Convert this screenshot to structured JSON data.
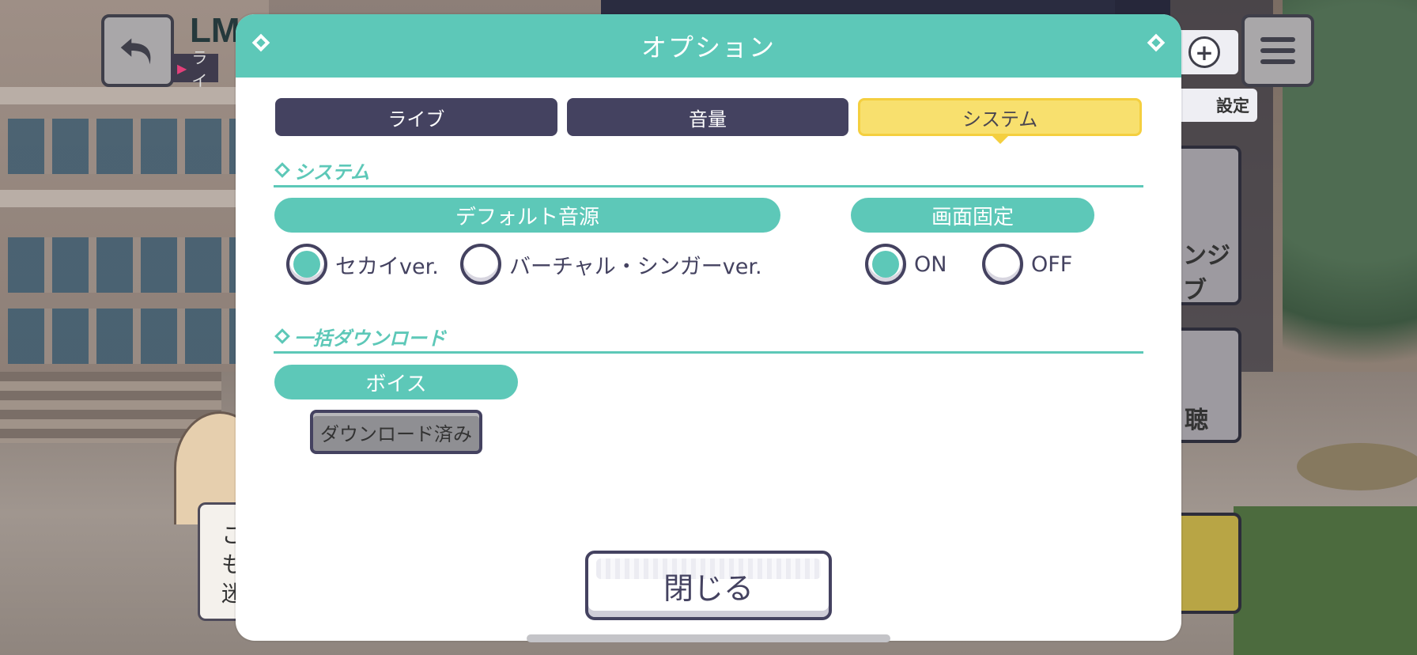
{
  "modal": {
    "title": "オプション",
    "tabs": [
      {
        "label": "ライブ",
        "active": false
      },
      {
        "label": "音量",
        "active": false
      },
      {
        "label": "システム",
        "active": true
      }
    ],
    "sections": {
      "system": {
        "title": "システム",
        "default_source": {
          "label": "デフォルト音源",
          "options": [
            {
              "label": "セカイver.",
              "selected": true
            },
            {
              "label": "バーチャル・シンガーver.",
              "selected": false
            }
          ]
        },
        "screen_lock": {
          "label": "画面固定",
          "options": [
            {
              "label": "ON",
              "selected": true
            },
            {
              "label": "OFF",
              "selected": false
            }
          ]
        }
      },
      "bulk_download": {
        "title": "一括ダウンロード",
        "voice": {
          "label": "ボイス",
          "button_label": "ダウンロード済み"
        }
      }
    },
    "close_label": "閉じる"
  },
  "background_ui": {
    "title_fragment": "LM",
    "subtab_fragment": "ライ",
    "settings_label": "設定",
    "card_texts": [
      "ンジ",
      "ブ",
      "聴"
    ],
    "speech_fragments": [
      "こ",
      "も",
      "迷"
    ]
  },
  "colors": {
    "accent_teal": "#5dc8b8",
    "tab_dark": "#444260",
    "tab_active_yellow": "#f8e06e",
    "radio_selected": "#5dc8b8"
  }
}
